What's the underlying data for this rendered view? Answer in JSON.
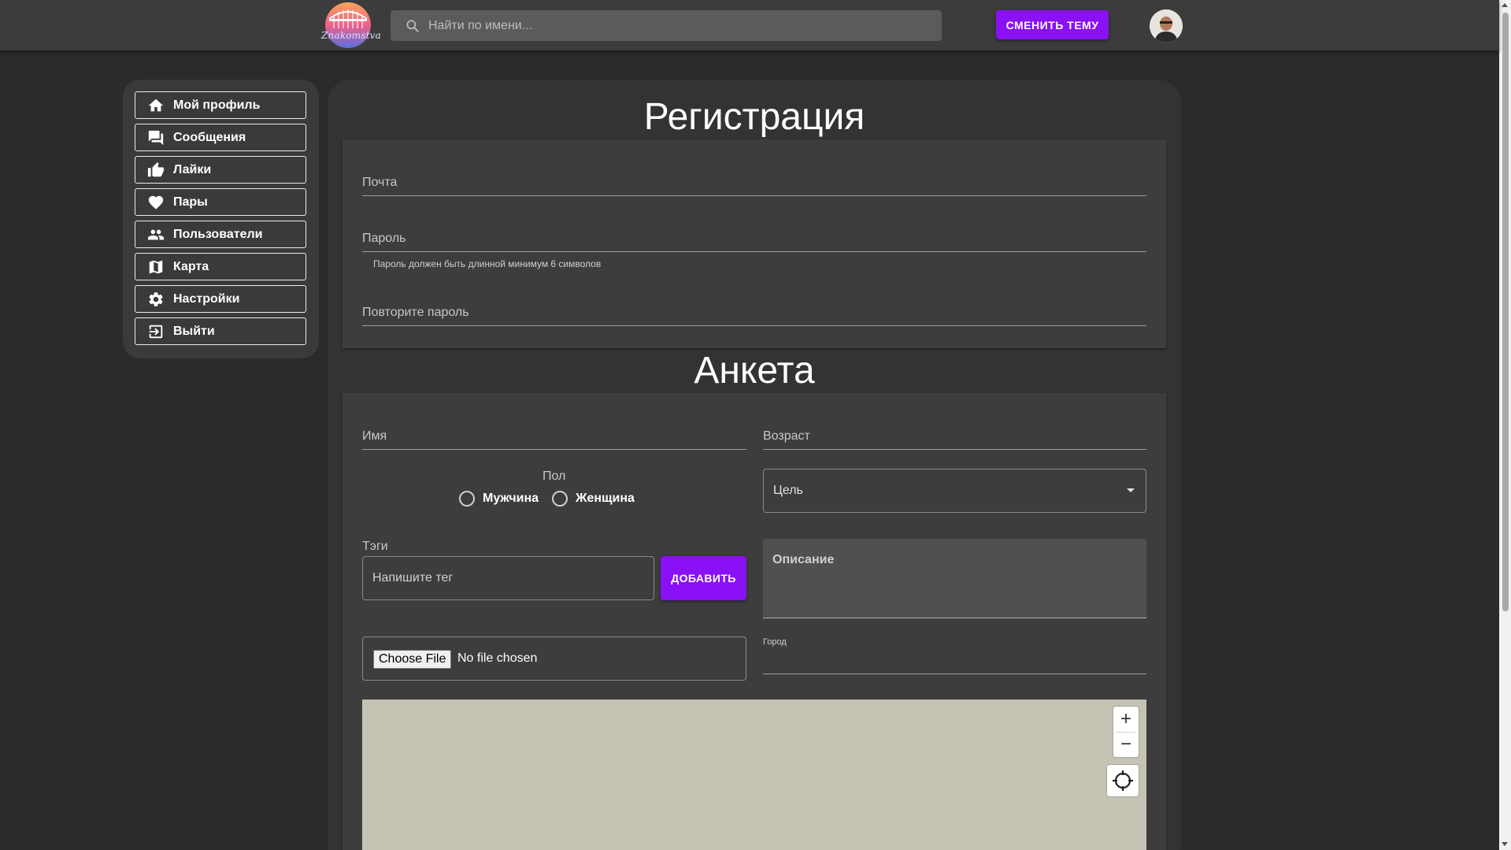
{
  "header": {
    "logo_text": "Znakomstva",
    "search_placeholder": "Найти по имени...",
    "theme_button": "СМЕНИТЬ ТЕМУ"
  },
  "sidebar": {
    "items": [
      {
        "label": "Мой профиль",
        "icon": "home-icon"
      },
      {
        "label": "Сообщения",
        "icon": "chat-icon"
      },
      {
        "label": "Лайки",
        "icon": "thumb-up-icon"
      },
      {
        "label": "Пары",
        "icon": "heart-icon"
      },
      {
        "label": "Пользователи",
        "icon": "people-icon"
      },
      {
        "label": "Карта",
        "icon": "map-icon"
      },
      {
        "label": "Настройки",
        "icon": "gear-icon"
      },
      {
        "label": "Выйти",
        "icon": "logout-icon"
      }
    ]
  },
  "registration": {
    "title": "Регистрация",
    "email_label": "Почта",
    "password_label": "Пароль",
    "password_helper": "Пароль должен быть длинной минимум 6 символов",
    "repeat_password_label": "Повторите пароль"
  },
  "profile": {
    "title": "Анкета",
    "name_label": "Имя",
    "age_label": "Возраст",
    "gender_label": "Пол",
    "gender_male": "Мужчина",
    "gender_female": "Женщина",
    "goal_label": "Цель",
    "tags_label": "Тэги",
    "tag_placeholder": "Напишите тег",
    "add_button": "ДОБАВИТЬ",
    "description_label": "Описание",
    "file_button": "Choose File",
    "file_status": "No file chosen",
    "city_label": "Город"
  },
  "map": {
    "zoom_in": "+",
    "zoom_out": "−"
  },
  "colors": {
    "accent": "#8a10f5",
    "background": "#2b2b2b",
    "appbar": "#3c3c3c",
    "card": "#333333",
    "panel": "#3d3d3d",
    "map": "#c4c3b4"
  }
}
